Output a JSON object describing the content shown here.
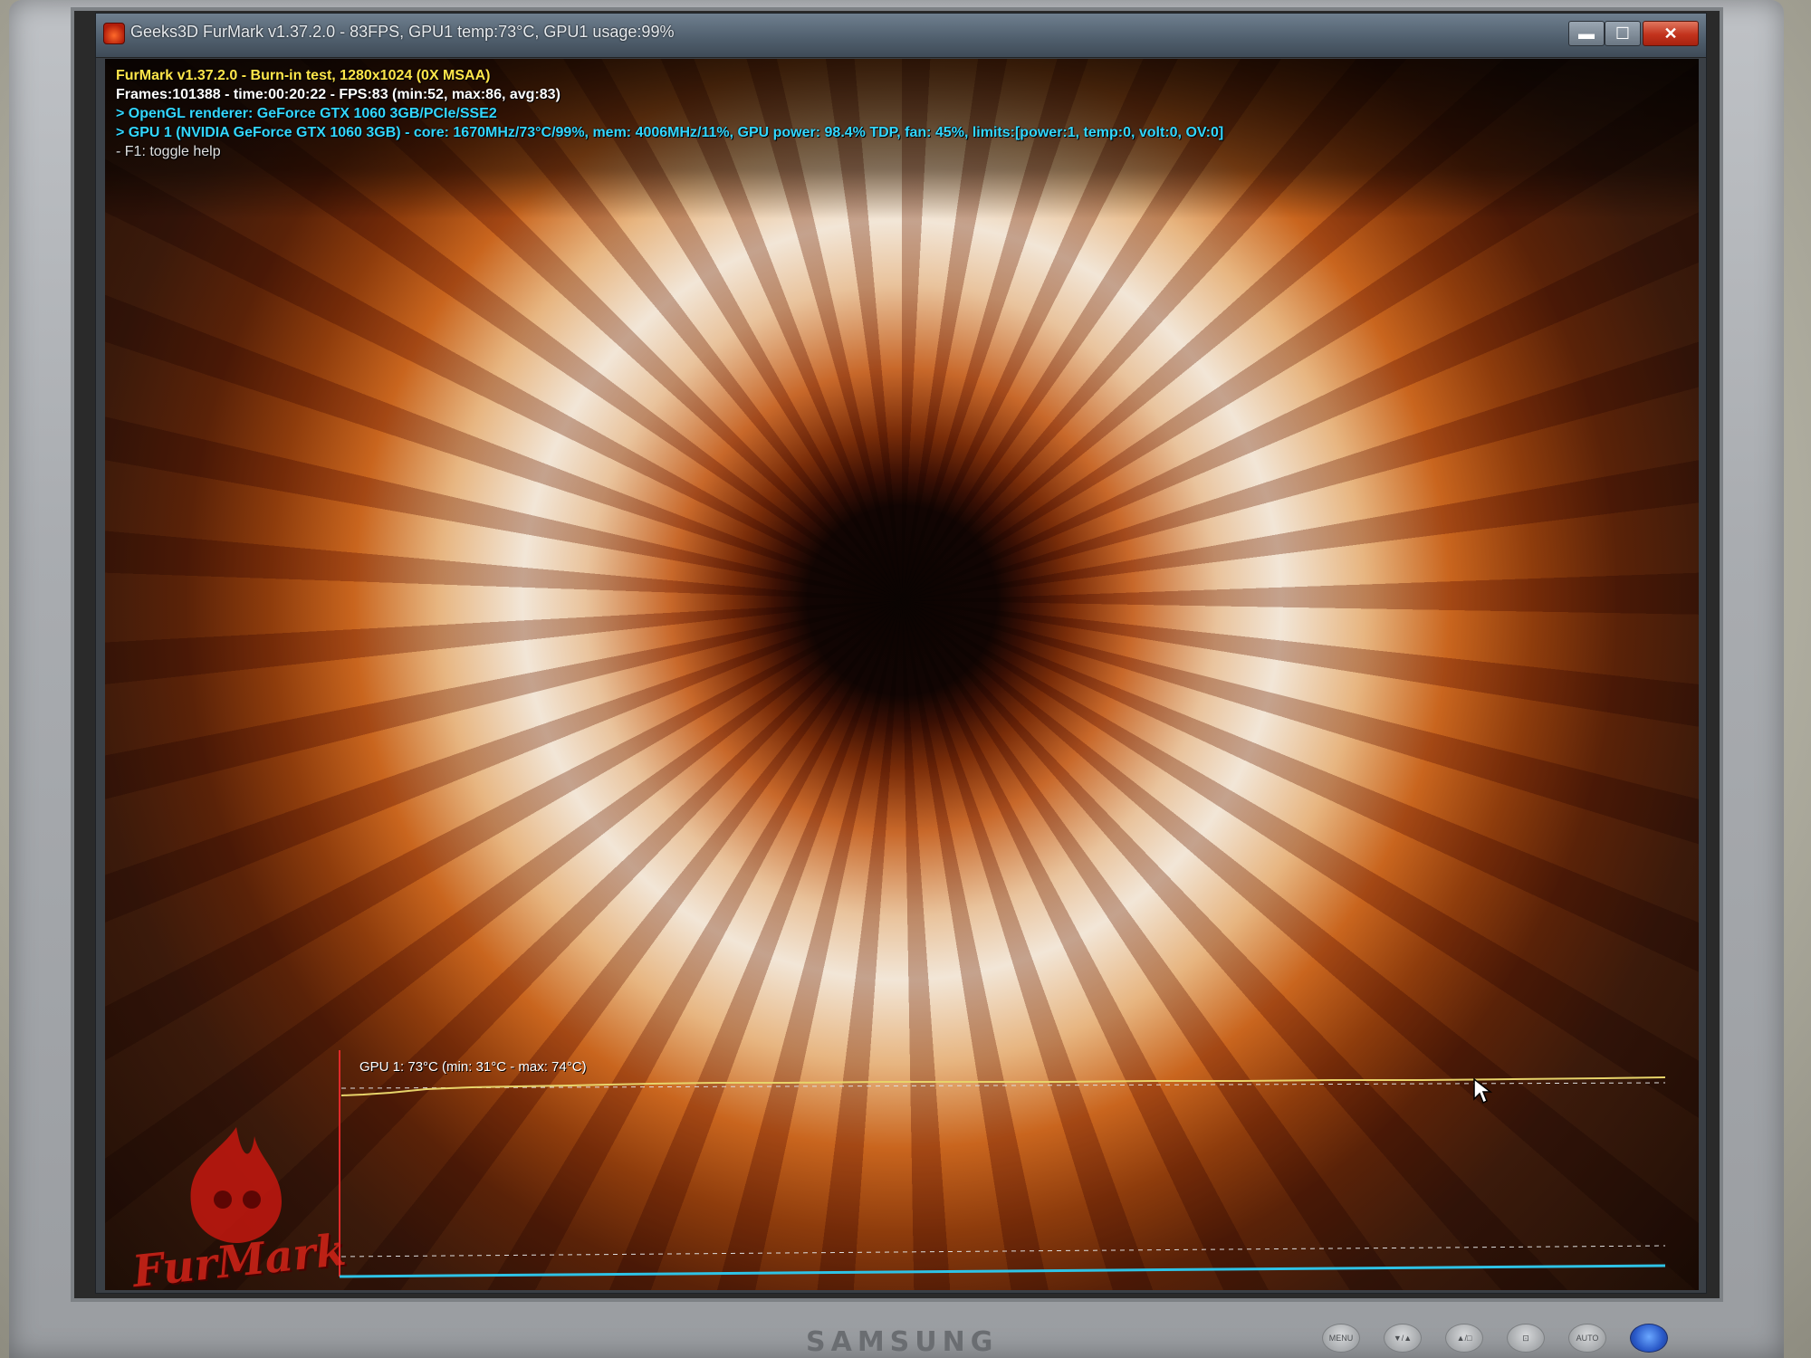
{
  "window": {
    "title": "Geeks3D FurMark v1.37.2.0 - 83FPS, GPU1 temp:73°C, GPU1 usage:99%",
    "buttons": {
      "minimize": "▬",
      "maximize": "☐",
      "close": "✕"
    }
  },
  "osd": {
    "line1": "FurMark v1.37.2.0 - Burn-in test, 1280x1024 (0X MSAA)",
    "line2": "Frames:101388 - time:00:20:22 - FPS:83 (min:52, max:86, avg:83)",
    "line3": "> OpenGL renderer: GeForce GTX 1060 3GB/PCIe/SSE2",
    "line4": "> GPU 1 (NVIDIA GeForce GTX 1060 3GB) - core: 1670MHz/73°C/99%, mem: 4006MHz/11%, GPU power: 98.4% TDP, fan: 45%, limits:[power:1, temp:0, volt:0, OV:0]",
    "line5": "- F1: toggle help"
  },
  "temp_graph": {
    "label": "GPU 1: 73°C (min: 31°C - max: 74°C)"
  },
  "logo": {
    "text": "FurMark"
  },
  "monitor": {
    "brand": "SAMSUNG",
    "buttons": [
      "MENU",
      "▼/▲",
      "▲/□",
      "⊡",
      "AUTO",
      ""
    ]
  },
  "colors": {
    "osd_title": "#ffe64a",
    "osd_stats": "#ffffff",
    "osd_gpu": "#33d7ff",
    "graph_line": "#e8d46a",
    "graph_axis_blue": "#2ec3e6",
    "graph_axis_red": "#e02a2a"
  }
}
